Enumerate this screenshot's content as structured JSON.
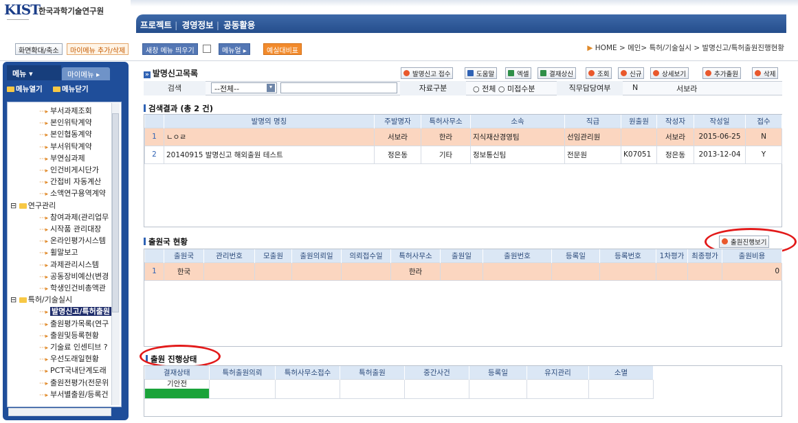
{
  "org": {
    "logo": "KIST",
    "name": "한국과학기술연구원"
  },
  "nav": [
    "프로젝트",
    "경영정보",
    "공동활용"
  ],
  "toolbar": {
    "zoom": "화면확대/축소",
    "add_my_menu": "마이메뉴 추가/삭제",
    "new_window_menu": "새창 메뉴 띄우기",
    "menu_dropdown": "메뉴얼",
    "compare": "예실대비표"
  },
  "breadcrumb": "HOME > 메인> 특허/기술실시 > 발명신고/특허출원진행현황",
  "sidebar": {
    "tab_menu": "메뉴",
    "tab_my": "마이메뉴",
    "open_all": "메뉴열기",
    "close_all": "메뉴닫기",
    "items": [
      "부서과제조회",
      "본인위탁계약",
      "본인협동계약",
      "부서위탁계약",
      "부연심과제",
      "인건비게시단가",
      "간접비 자동계산",
      "소액연구용역계약",
      "연구관리",
      "참여과제(관리업무",
      "시작품 관리대장",
      "온라인평가시스템",
      "휠말보고",
      "과제관리시스템",
      "공동장비예산(변경",
      "학생인건비총액관",
      "특허/기술실시",
      "발명신고/특허출원",
      "출원평가목록(연구",
      "출원및등록현황",
      "기술료 인센티브 ?",
      "우선도래일현황",
      "PCT국내단계도래",
      "출원전평가(전문위",
      "부서별출원/등록건"
    ]
  },
  "list_panel": {
    "title": "발명신고목록",
    "buttons": [
      "발명신고 접수",
      "도움말",
      "엑셀",
      "결재상신",
      "조회",
      "신규",
      "상세보기",
      "추가출원",
      "삭제"
    ],
    "search_label": "검색",
    "search_select": "--전체--",
    "search_value": "",
    "type_label": "자료구분",
    "radio_all": "전체",
    "radio_unreceived": "미접수분",
    "duty_label": "직무담당여부",
    "duty_value": "N",
    "person": "서보라"
  },
  "results": {
    "title": "검색결과 (총 2 건)",
    "columns": [
      "발명의 명칭",
      "주발명자",
      "특허사무소",
      "소속",
      "직급",
      "원출원",
      "작성자",
      "작성일",
      "접수"
    ],
    "rows": [
      {
        "no": "1",
        "name": "ㄴㅇㄹ",
        "inventor": "서보라",
        "office": "한라",
        "dept": "지식재산경영팀",
        "rank": "선임관리원",
        "orig": "",
        "writer": "서보라",
        "date": "2015-06-25",
        "rcv": "N"
      },
      {
        "no": "2",
        "name": "20140915 발명신고 해외출원 테스트",
        "inventor": "정은동",
        "office": "기타",
        "dept": "정보통신팀",
        "rank": "전문원",
        "orig": "K07051",
        "writer": "정은동",
        "date": "2013-12-04",
        "rcv": "Y"
      }
    ]
  },
  "country": {
    "title": "출원국 현황",
    "button": "출원진행보기",
    "columns": [
      "출원국",
      "관리번호",
      "모출원",
      "출원의뢰일",
      "의뢰접수일",
      "특허사무소",
      "출원일",
      "출원번호",
      "등록일",
      "등록번호",
      "1차평가",
      "최종평가",
      "출원비용"
    ],
    "row": {
      "no": "1",
      "country": "한국",
      "office": "한라",
      "cost": "0"
    }
  },
  "progress": {
    "title": "출원 진행상태",
    "columns": [
      "결재상태",
      "특허출원의뢰",
      "특허사무소접수",
      "특허출원",
      "중간사건",
      "등록일",
      "유지관리",
      "소멸"
    ],
    "status": "기안전"
  },
  "colors": {
    "nav": "#254e8c",
    "sidebar": "#1f4e9a",
    "row_highlight": "#fbd6c0",
    "status_green": "#1aa33a",
    "annotation": "#e21a1a"
  }
}
